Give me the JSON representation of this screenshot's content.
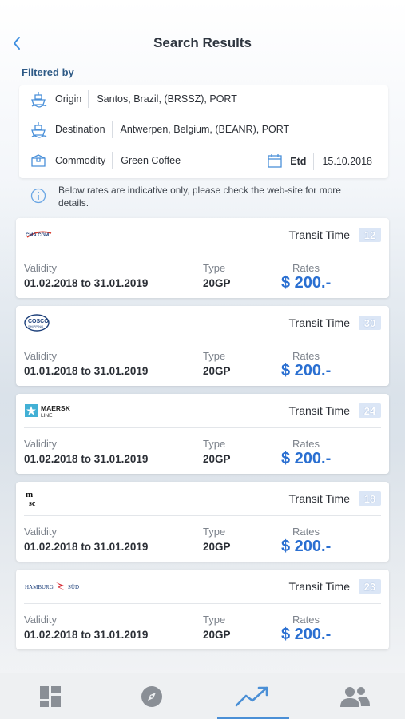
{
  "header": {
    "title": "Search Results",
    "back_icon": "chevron-left-icon"
  },
  "filters": {
    "heading": "Filtered by",
    "origin": {
      "label": "Origin",
      "value": "Santos, Brazil, (BRSSZ), PORT",
      "icon": "ship-icon"
    },
    "destination": {
      "label": "Destination",
      "value": "Antwerpen, Belgium, (BEANR), PORT",
      "icon": "ship-icon"
    },
    "commodity": {
      "label": "Commodity",
      "value": "Green Coffee",
      "icon": "box-icon"
    },
    "etd": {
      "label": "Etd",
      "value": "15.10.2018",
      "icon": "calendar-icon"
    }
  },
  "note": {
    "text": "Below rates are indicative only, please check the web-site for more details.",
    "icon": "info-icon"
  },
  "labels": {
    "transit": "Transit Time",
    "validity": "Validity",
    "type": "Type",
    "rates": "Rates"
  },
  "results": [
    {
      "carrier": "CMA CGM",
      "transit_days": "12",
      "validity": "01.02.2018 to 31.01.2019",
      "type": "20GP",
      "rate": "$ 200.-"
    },
    {
      "carrier": "COSCO SHIPPING",
      "transit_days": "30",
      "validity": "01.01.2018 to 31.01.2019",
      "type": "20GP",
      "rate": "$ 200.-"
    },
    {
      "carrier": "MAERSK LINE",
      "transit_days": "24",
      "validity": "01.02.2018 to 31.01.2019",
      "type": "20GP",
      "rate": "$ 200.-"
    },
    {
      "carrier": "MSC",
      "transit_days": "18",
      "validity": "01.02.2018 to 31.01.2019",
      "type": "20GP",
      "rate": "$ 200.-"
    },
    {
      "carrier": "HAMBURG SÜD",
      "transit_days": "23",
      "validity": "01.02.2018 to 31.01.2019",
      "type": "20GP",
      "rate": "$ 200.-"
    }
  ],
  "logo_text": {
    "cma": "CMA CGM",
    "cosco_top": "COSCO",
    "cosco_bottom": "SHIPPING",
    "maersk_top": "MAERSK",
    "maersk_bottom": "LINE",
    "msc_top": "m",
    "msc_bottom": "sc",
    "hamburg_left": "HAMBURG",
    "hamburg_right": "SÜD"
  },
  "tabbar": {
    "tabs": [
      {
        "name": "dashboard",
        "icon": "dashboard-icon"
      },
      {
        "name": "explore",
        "icon": "compass-icon"
      },
      {
        "name": "rates",
        "icon": "trending-up-icon",
        "active": true
      },
      {
        "name": "contacts",
        "icon": "people-icon"
      }
    ]
  },
  "colors": {
    "accent": "#2a6fd1",
    "heading": "#2e5a86",
    "badge": "#dbe6f6",
    "tab_active": "#4a8fd6"
  }
}
